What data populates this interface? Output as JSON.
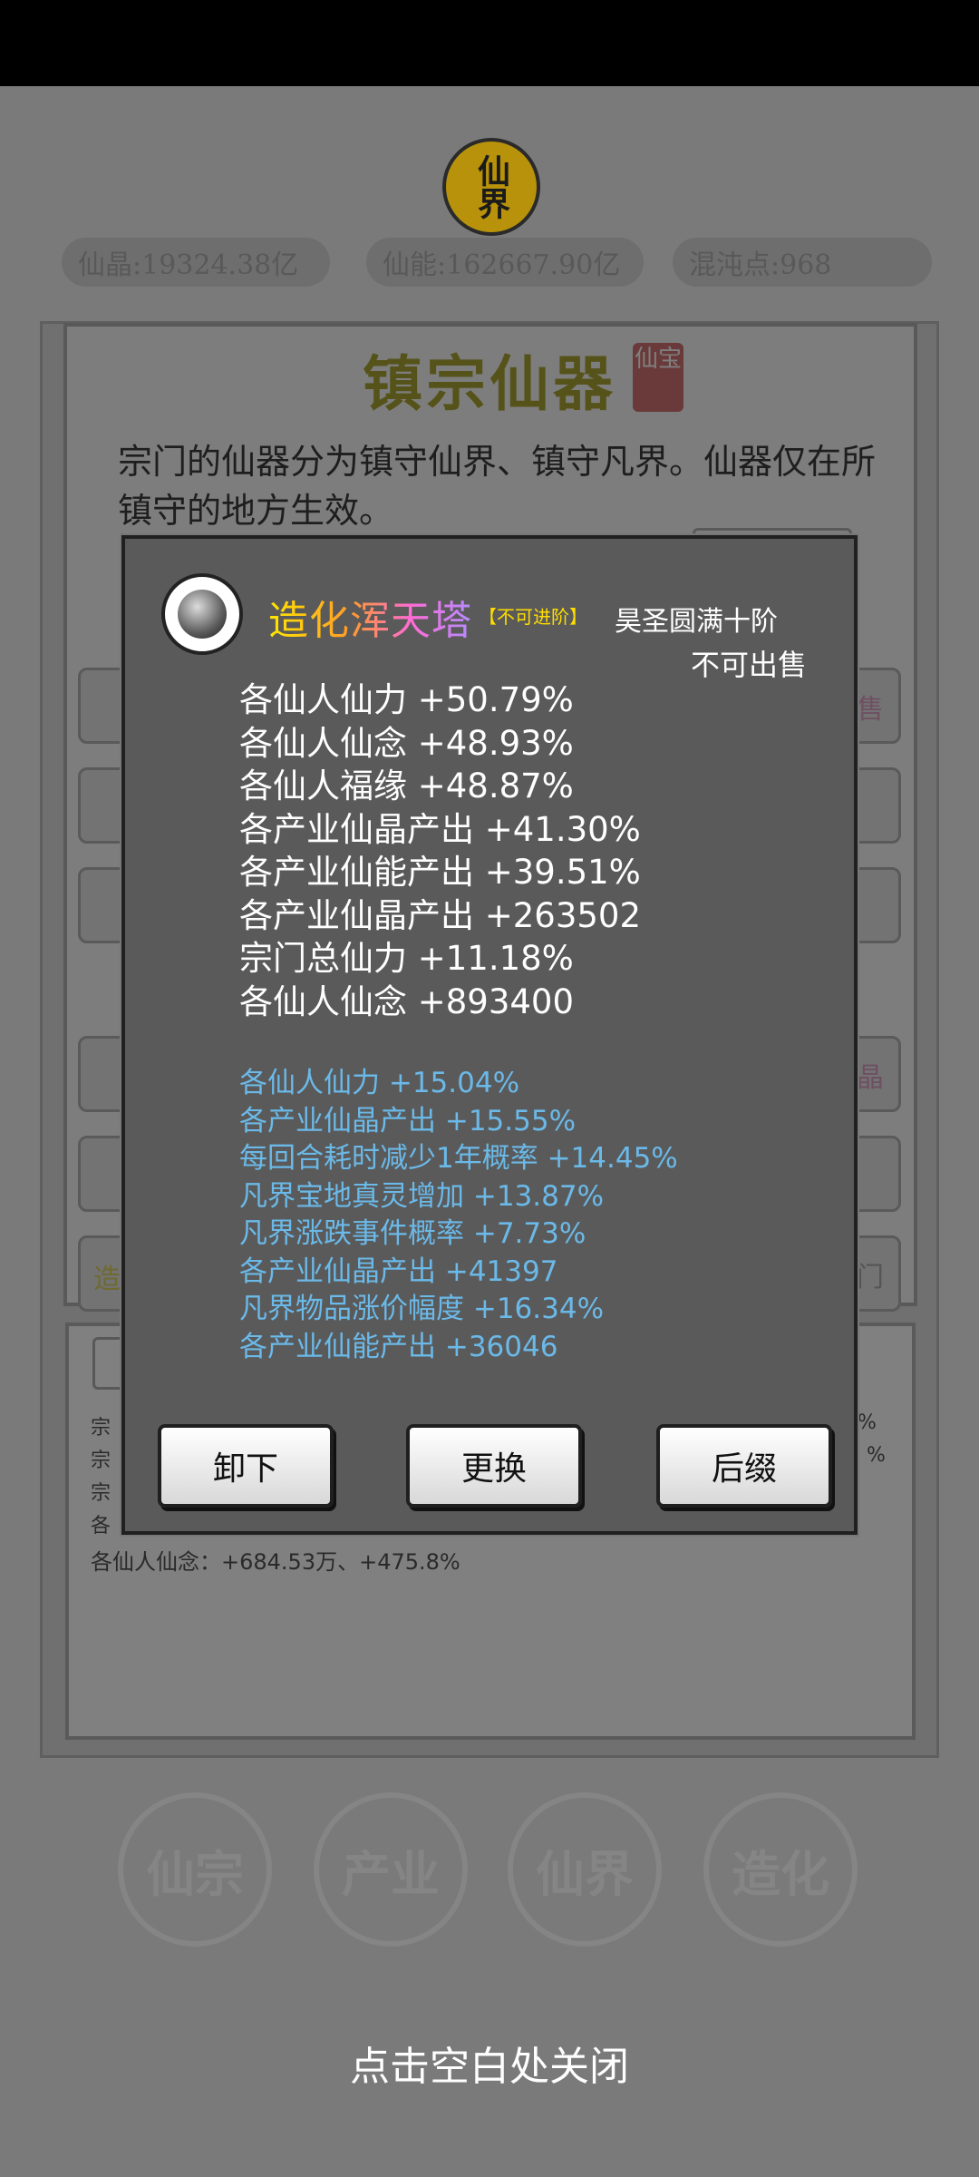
{
  "header": {
    "logo_text": "仙界",
    "resources": [
      {
        "label": "仙晶:19324.38亿"
      },
      {
        "label": "仙能:162667.90亿"
      },
      {
        "label": "混沌点:968"
      }
    ]
  },
  "page": {
    "title": "镇宗仙器",
    "seal": "仙宝",
    "description": "宗门的仙器分为镇守仙界、镇守凡界。仙器仅在所镇守的地方生效。",
    "row_right_1": "售",
    "row_right_2": "晶",
    "row_left_3": "造",
    "row_right_3": "门",
    "lower_frag_1": "宗",
    "lower_frag_2": "宗",
    "lower_frag_3": "宗",
    "lower_frag_4": "各",
    "lower_right_1": "%",
    "lower_right_2": "%",
    "lower_stat": "各仙人仙念：+684.53万、+475.8%"
  },
  "nav": {
    "tabs": [
      {
        "label": "仙宗"
      },
      {
        "label": "产业"
      },
      {
        "label": "仙界"
      },
      {
        "label": "造化"
      }
    ]
  },
  "close_hint": "点击空白处关闭",
  "modal": {
    "item_name": "造化浑天塔",
    "tag": "【不可进阶】",
    "rank": "昊圣圆满十阶",
    "sale_status": "不可出售",
    "main_stats": [
      "各仙人仙力 +50.79%",
      "各仙人仙念 +48.93%",
      "各仙人福缘 +48.87%",
      "各产业仙晶产出 +41.30%",
      "各产业仙能产出 +39.51%",
      "各产业仙晶产出 +263502",
      "宗门总仙力 +11.18%",
      "各仙人仙念 +893400"
    ],
    "suffix_stats": [
      "各仙人仙力 +15.04%",
      "各产业仙晶产出 +15.55%",
      "每回合耗时减少1年概率 +14.45%",
      "凡界宝地真灵增加 +13.87%",
      "凡界涨跌事件概率 +7.73%",
      "各产业仙晶产出 +41397",
      "凡界物品涨价幅度 +16.34%",
      "各产业仙能产出 +36046"
    ],
    "buttons": {
      "unequip": "卸下",
      "replace": "更换",
      "suffix": "后缀"
    }
  }
}
